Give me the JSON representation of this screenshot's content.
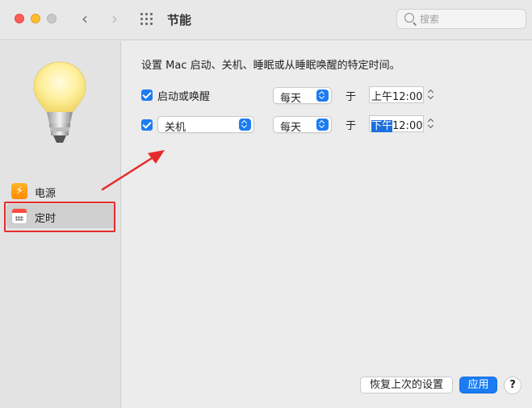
{
  "window": {
    "title": "节能",
    "search_placeholder": "搜索"
  },
  "sidebar": {
    "items": [
      {
        "label": "电源",
        "icon": "bolt-icon"
      },
      {
        "label": "定时",
        "icon": "calendar-icon",
        "selected": true
      }
    ]
  },
  "main": {
    "description": "设置 Mac 启动、关机、睡眠或从睡眠唤醒的特定时间。",
    "rows": [
      {
        "checked": true,
        "action": "启动或唤醒",
        "frequency": "每天",
        "at": "于",
        "time_period": "上午",
        "time_value": "12:00"
      },
      {
        "checked": true,
        "action": "关机",
        "frequency": "每天",
        "at": "于",
        "time_period": "下午",
        "time_value": "12:00"
      }
    ],
    "buttons": {
      "restore": "恢复上次的设置",
      "apply": "应用",
      "help": "?"
    }
  },
  "colors": {
    "accent": "#1c7cf2",
    "annotation": "#e52b2b"
  }
}
